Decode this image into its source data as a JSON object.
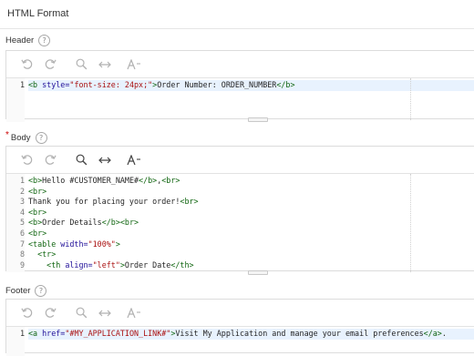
{
  "page": {
    "title": "HTML Format"
  },
  "help_glyph": "?",
  "required_mark": "*",
  "header": {
    "label": "Header",
    "line_numbers": [
      "1"
    ],
    "lines": [
      [
        {
          "t": "tag",
          "v": "<b "
        },
        {
          "t": "attr",
          "v": "style="
        },
        {
          "t": "str",
          "v": "\"font-size: 24px;\""
        },
        {
          "t": "tag",
          "v": ">"
        },
        {
          "t": "text",
          "v": "Order Number: ORDER_NUMBER"
        },
        {
          "t": "tag",
          "v": "</b>"
        }
      ]
    ]
  },
  "body": {
    "label": "Body",
    "line_numbers": [
      "1",
      "2",
      "3",
      "4",
      "5",
      "6",
      "7",
      "8",
      "9"
    ],
    "lines": [
      [
        {
          "t": "tag",
          "v": "<b>"
        },
        {
          "t": "text",
          "v": "Hello #CUSTOMER_NAME#"
        },
        {
          "t": "tag",
          "v": "</b>"
        },
        {
          "t": "text",
          "v": ","
        },
        {
          "t": "tag",
          "v": "<br>"
        }
      ],
      [
        {
          "t": "tag",
          "v": "<br>"
        }
      ],
      [
        {
          "t": "text",
          "v": "Thank you for placing your order!"
        },
        {
          "t": "tag",
          "v": "<br>"
        }
      ],
      [
        {
          "t": "tag",
          "v": "<br>"
        }
      ],
      [
        {
          "t": "tag",
          "v": "<b>"
        },
        {
          "t": "text",
          "v": "Order Details"
        },
        {
          "t": "tag",
          "v": "</b><br>"
        }
      ],
      [
        {
          "t": "tag",
          "v": "<br>"
        }
      ],
      [
        {
          "t": "tag",
          "v": "<table "
        },
        {
          "t": "attr",
          "v": "width="
        },
        {
          "t": "str",
          "v": "\"100%\""
        },
        {
          "t": "tag",
          "v": ">"
        }
      ],
      [
        {
          "t": "text",
          "v": "  "
        },
        {
          "t": "tag",
          "v": "<tr>"
        }
      ],
      [
        {
          "t": "text",
          "v": "    "
        },
        {
          "t": "tag",
          "v": "<th "
        },
        {
          "t": "attr",
          "v": "align="
        },
        {
          "t": "str",
          "v": "\"left\""
        },
        {
          "t": "tag",
          "v": ">"
        },
        {
          "t": "text",
          "v": "Order Date"
        },
        {
          "t": "tag",
          "v": "</th>"
        }
      ]
    ]
  },
  "footer": {
    "label": "Footer",
    "line_numbers": [
      "1"
    ],
    "lines": [
      [
        {
          "t": "tag",
          "v": "<a "
        },
        {
          "t": "attr",
          "v": "href="
        },
        {
          "t": "str",
          "v": "\"#MY_APPLICATION_LINK#\""
        },
        {
          "t": "tag",
          "v": ">"
        },
        {
          "t": "text",
          "v": "Visit My Application and manage your email preferences"
        },
        {
          "t": "tag",
          "v": "</a>"
        },
        {
          "t": "text",
          "v": "."
        }
      ]
    ]
  },
  "toolbar_icons": [
    "undo-icon",
    "redo-icon",
    "search-icon",
    "resize-horizontal-icon",
    "font-size-icon"
  ],
  "colors": {
    "tag": "#116611",
    "attr": "#221199",
    "string": "#aa1111",
    "active_line": "#e8f2fe"
  }
}
